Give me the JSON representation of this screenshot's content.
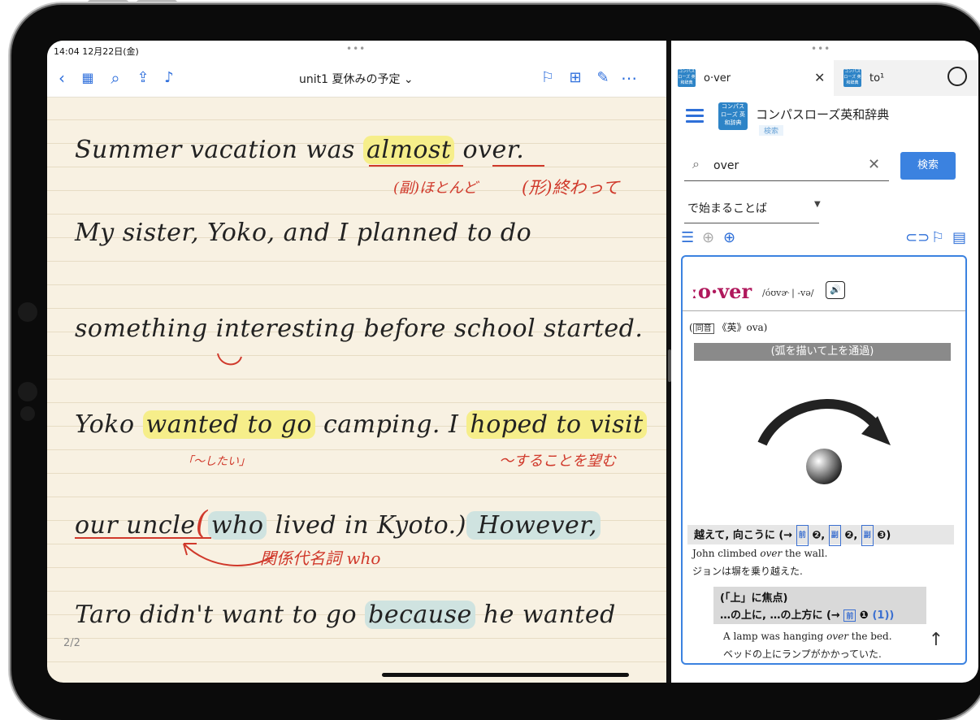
{
  "left": {
    "status_time": "14:04  12月22日(金)",
    "top_dots": "•••",
    "title": "unit1 夏休みの予定 ⌄",
    "toolbar_icons": [
      "back-icon",
      "grid-icon",
      "search-icon",
      "share-icon",
      "mic-icon",
      "bookmark-icon",
      "add-page-icon",
      "pen-icon",
      "more-icon"
    ],
    "page_indicator": "2/2",
    "lines": [
      {
        "pre": "Summer vacation was ",
        "hl": "almost",
        "mid": " ",
        "after": "over."
      },
      {
        "text": "My sister, Yoko, and I planned to do"
      },
      {
        "text": "something interesting before school started."
      },
      {
        "pre": "Yoko ",
        "hl1": "wanted to go",
        "mid": " camping. I ",
        "hl2": "hoped to visit"
      },
      {
        "pre": "our uncle",
        "mid": "(",
        "hl": "who",
        "after": " lived in Kyoto.)",
        "hl2": " However,"
      },
      {
        "pre": "Taro didn't want to go ",
        "hl": "because",
        "after": " he wanted"
      }
    ],
    "notes": {
      "n1": "(副)ほとんど",
      "n2": "(形)終わって",
      "n3": "「～したい」",
      "n4": "～することを望む",
      "n5": "関係代名詞 who"
    }
  },
  "right": {
    "top_dots": "•••",
    "tabs": [
      {
        "logo": "コンパス ローズ 英和辞典",
        "label": "o·ver",
        "close": "✕"
      },
      {
        "logo": "コンパス ローズ 英和辞典",
        "label": "to¹"
      }
    ],
    "dict_logo": "コンパス ローズ 英和辞典",
    "dict_name": "コンパスローズ英和辞典",
    "dict_sub": "検索",
    "search": {
      "value": "over",
      "clear": "✕",
      "button": "検索"
    },
    "mode": {
      "label": "で始まることば",
      "caret": "▼"
    },
    "entry": {
      "headword": "ːo·ver",
      "pron": "/óʊvɚ | -və/",
      "speaker": "🔊",
      "homo_box": "同音",
      "homo_text": "《英》ova)",
      "gray_label": "(弧を描いて上を通過)",
      "sense": "越えて, 向こうに (→",
      "sense_refs": [
        "前",
        "副",
        "副"
      ],
      "sense_nums": [
        "❷",
        "❷",
        "❸"
      ],
      "ex1_en_a": "John climbed ",
      "ex1_en_b": "over",
      "ex1_en_c": " the wall.",
      "ex1_ja": "ジョンは塀を乗り越えた.",
      "focus_a": "(「上」に焦点)",
      "focus_b": "…の上に, …の上方に (→",
      "focus_ref": "前",
      "focus_num": "❶",
      "focus_sub": "(1))",
      "ex2_en_a": "A lamp was hanging ",
      "ex2_en_b": "over",
      "ex2_en_c": " the bed.",
      "ex2_ja": "ベッドの上にランプがかかっていた."
    }
  }
}
